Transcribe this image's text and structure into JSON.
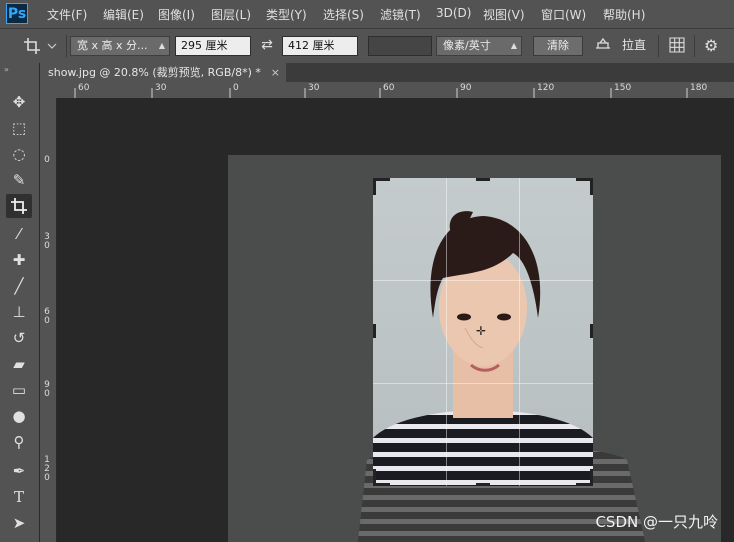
{
  "app": {
    "logo": "Ps"
  },
  "menu": [
    {
      "label": "文件(F)"
    },
    {
      "label": "编辑(E)"
    },
    {
      "label": "图像(I)"
    },
    {
      "label": "图层(L)"
    },
    {
      "label": "类型(Y)"
    },
    {
      "label": "选择(S)"
    },
    {
      "label": "滤镜(T)"
    },
    {
      "label": "3D(D)"
    },
    {
      "label": "视图(V)"
    },
    {
      "label": "窗口(W)"
    },
    {
      "label": "帮助(H)"
    }
  ],
  "options": {
    "ratio_preset": "宽 x 高 x 分...",
    "width": "295 厘米",
    "swap_icon": "swap-arrows",
    "height": "412 厘米",
    "resolution": "",
    "resolution_unit": "像素/英寸",
    "clear_label": "清除",
    "straighten_label": "拉直"
  },
  "document": {
    "tab_title": "show.jpg @ 20.8% (裁剪预览, RGB/8*) *",
    "close": "×"
  },
  "ruler_h": [
    "60",
    "30",
    "0",
    "30",
    "60",
    "90",
    "120",
    "150",
    "180"
  ],
  "ruler_v": [
    "0",
    "3\n0",
    "6\n0",
    "9\n0",
    "1\n2\n0"
  ],
  "tools": [
    "move-tool",
    "marquee-tool",
    "lasso-tool",
    "quick-select-tool",
    "crop-tool",
    "eyedropper-tool",
    "healing-brush-tool",
    "brush-tool",
    "clone-stamp-tool",
    "history-brush-tool",
    "eraser-tool",
    "gradient-tool",
    "blur-tool",
    "dodge-tool",
    "pen-tool",
    "type-tool",
    "path-select-tool"
  ],
  "watermark": "CSDN @一只九呤"
}
